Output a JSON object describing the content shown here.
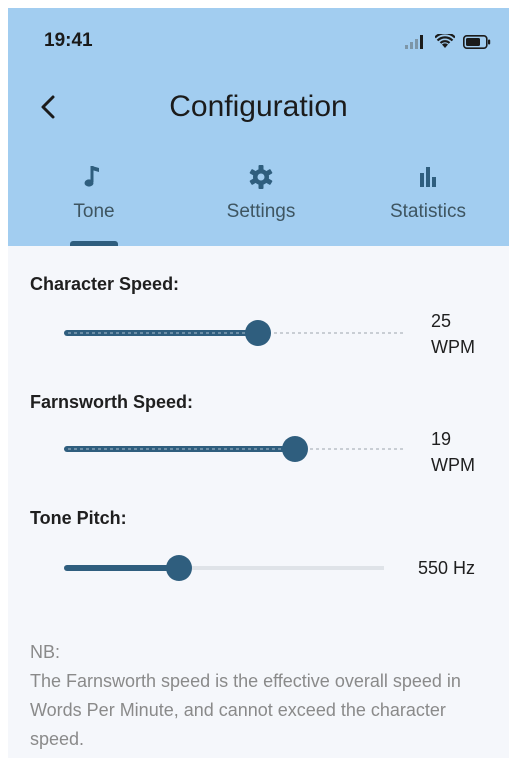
{
  "status": {
    "time": "19:41"
  },
  "header": {
    "title": "Configuration"
  },
  "tabs": [
    {
      "label": "Tone",
      "icon": "music-note-icon",
      "active": true
    },
    {
      "label": "Settings",
      "icon": "gear-icon",
      "active": false
    },
    {
      "label": "Statistics",
      "icon": "bar-chart-icon",
      "active": false
    }
  ],
  "sliders": {
    "character": {
      "label": "Character Speed:",
      "value": "25",
      "unit": "WPM",
      "fraction": 0.57
    },
    "farnsworth": {
      "label": "Farnsworth Speed:",
      "value": "19",
      "unit": "WPM",
      "fraction": 0.68
    },
    "pitch": {
      "label": "Tone Pitch:",
      "value": "550 Hz",
      "fraction": 0.36
    }
  },
  "note": {
    "title": "NB:",
    "text": "The Farnsworth speed is the effective overall speed in Words Per Minute, and cannot exceed the character speed."
  },
  "colors": {
    "header": "#a2cdf0",
    "accent": "#2f5e7e",
    "background": "#f5f7fb"
  }
}
